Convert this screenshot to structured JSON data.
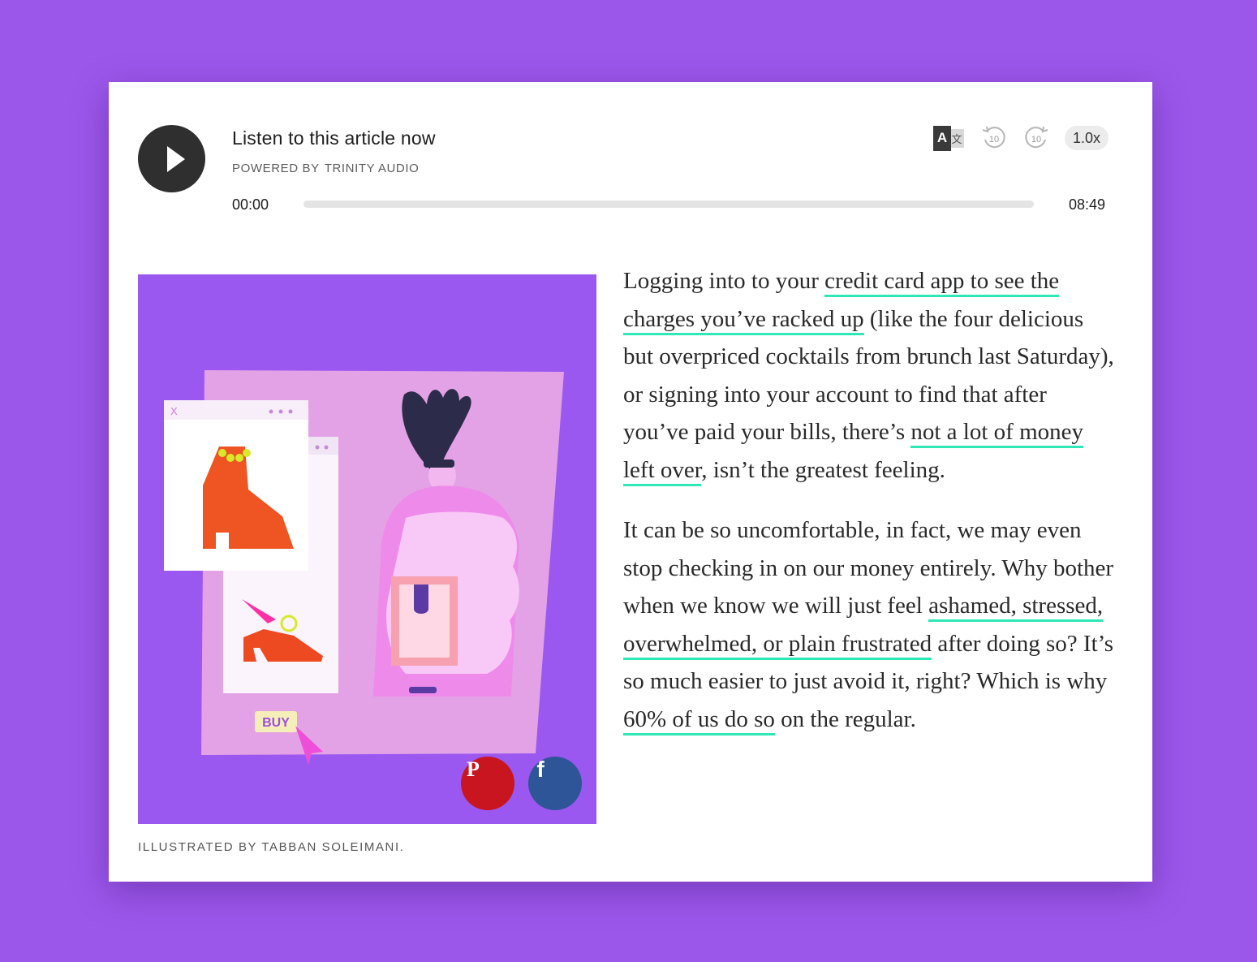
{
  "player": {
    "title": "Listen to this article now",
    "powered_label": "POWERED BY",
    "powered_brand": "TRINITY AUDIO",
    "time_current": "00:00",
    "time_total": "08:49",
    "progress": 0,
    "speed": "1.0x",
    "rewind_label": "10",
    "forward_label": "10",
    "translate_a": "A",
    "translate_zh": "文"
  },
  "figure": {
    "buy_label": "BUY",
    "caption": "ILLUSTRATED BY TABBAN SOLEIMANI."
  },
  "share": {
    "pinterest_glyph": "P",
    "facebook_glyph": "f"
  },
  "article": {
    "p1": {
      "t1": "Logging into to your ",
      "link1": "credit card app to see the charges you’ve racked up",
      "t2": " (like the four delicious but overpriced cocktails from brunch last Saturday), or signing into your account to find that after you’ve paid your bills, there’s ",
      "link2": "not a lot of money left over",
      "t3": ", isn’t the greatest feeling."
    },
    "p2": {
      "t1": "It can be so uncomfortable, in fact, we may even stop checking in on our money entirely. Why bother when we know we will just feel ",
      "link1": "ashamed, stressed, overwhelmed, or plain frustrated",
      "t2": " after doing so? It’s so much easier to just avoid it, right? Which is why ",
      "link2": "60% of us do so",
      "t3": " on the regular."
    }
  },
  "colors": {
    "background": "#9b57ea",
    "link_underline": "#2ee8b6",
    "pinterest": "#c8151f",
    "facebook": "#2f5599"
  },
  "icons": {
    "play": "play-icon",
    "translate": "translate-icon",
    "rewind": "rewind-10-icon",
    "forward": "forward-10-icon",
    "pinterest": "pinterest-icon",
    "facebook": "facebook-icon"
  }
}
